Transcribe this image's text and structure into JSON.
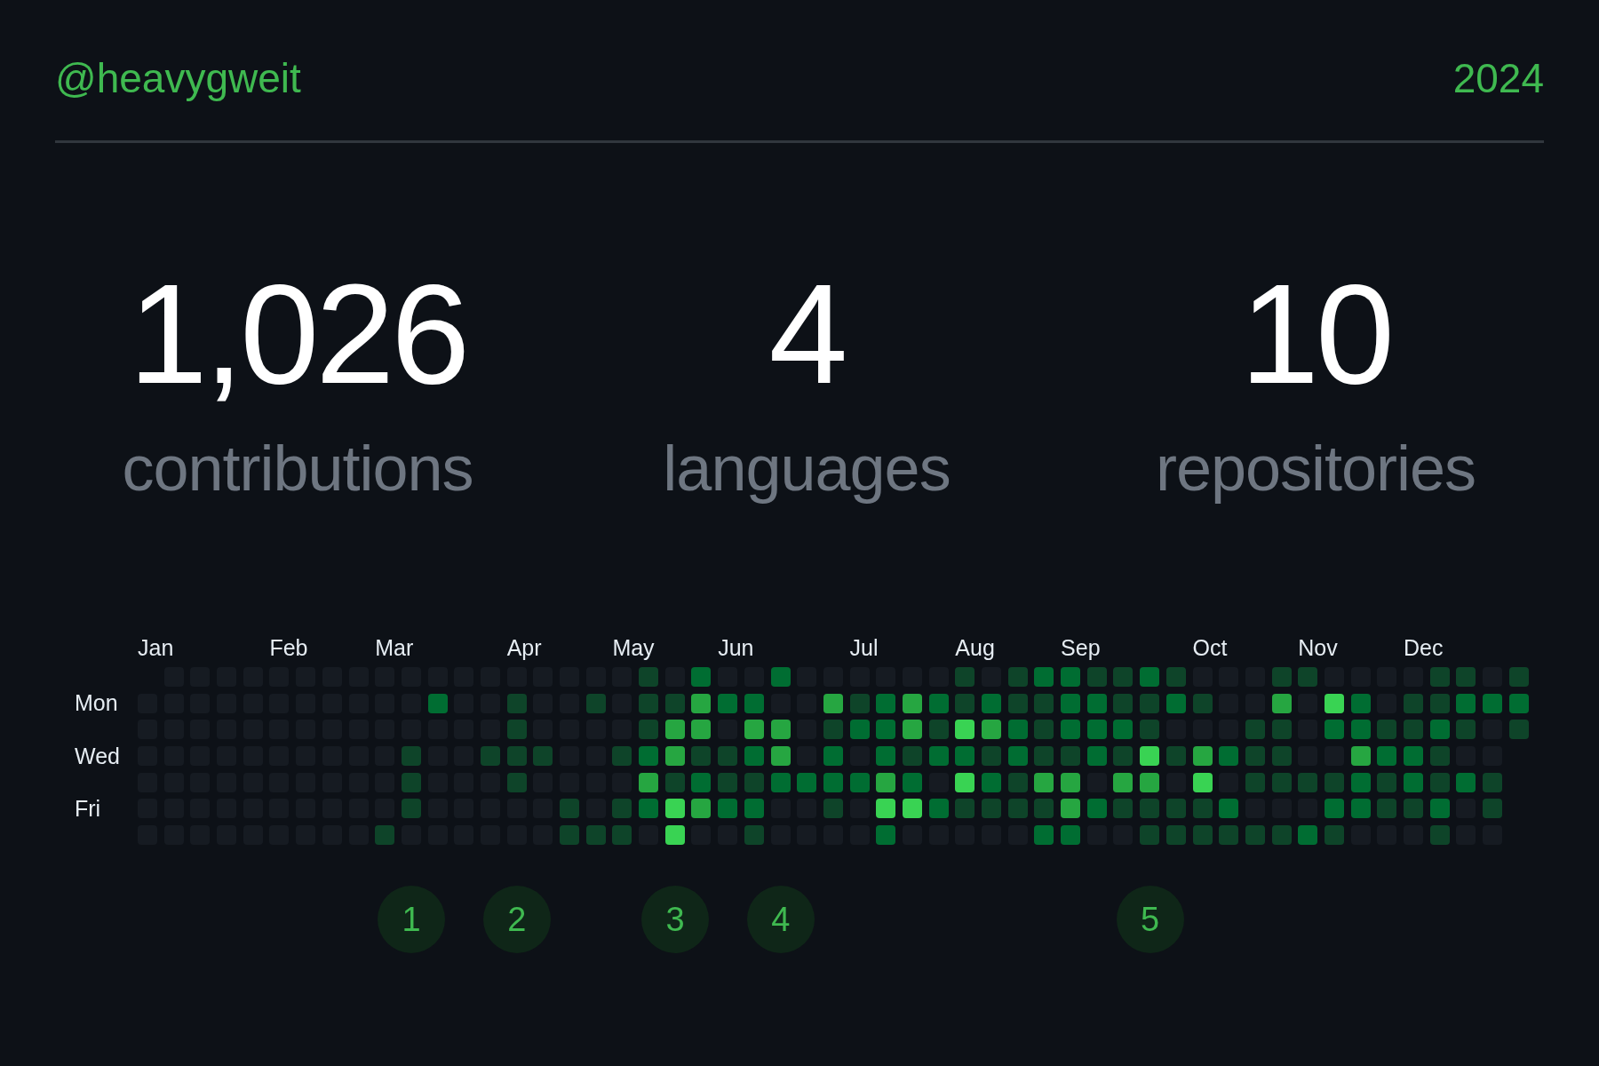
{
  "header": {
    "username": "@heavygweit",
    "year": "2024"
  },
  "stats": [
    {
      "value": "1,026",
      "label": "contributions"
    },
    {
      "value": "4",
      "label": "languages"
    },
    {
      "value": "10",
      "label": "repositories"
    }
  ],
  "calendar": {
    "day_labels": [
      {
        "row": "Mon"
      },
      {
        "row": "Wed"
      },
      {
        "row": "Fri"
      }
    ],
    "weeks": [
      {
        "month": "Jan",
        "days": [
          {
            "color": "#161b22"
          },
          {
            "color": "#161b22"
          },
          {
            "color": "#161b22"
          },
          {
            "color": "#161b22"
          },
          {
            "color": "#161b22"
          },
          {
            "color": "#161b22"
          }
        ]
      },
      {
        "days": [
          {
            "color": "#161b22"
          },
          {
            "color": "#161b22"
          },
          {
            "color": "#161b22"
          },
          {
            "color": "#161b22"
          },
          {
            "color": "#161b22"
          },
          {
            "color": "#161b22"
          },
          {
            "color": "#161b22"
          }
        ]
      },
      {
        "days": [
          {
            "color": "#161b22"
          },
          {
            "color": "#161b22"
          },
          {
            "color": "#161b22"
          },
          {
            "color": "#161b22"
          },
          {
            "color": "#161b22"
          },
          {
            "color": "#161b22"
          },
          {
            "color": "#161b22"
          }
        ]
      },
      {
        "days": [
          {
            "color": "#161b22"
          },
          {
            "color": "#161b22"
          },
          {
            "color": "#161b22"
          },
          {
            "color": "#161b22"
          },
          {
            "color": "#161b22"
          },
          {
            "color": "#161b22"
          },
          {
            "color": "#161b22"
          }
        ]
      },
      {
        "days": [
          {
            "color": "#161b22"
          },
          {
            "color": "#161b22"
          },
          {
            "color": "#161b22"
          },
          {
            "color": "#161b22"
          },
          {
            "color": "#161b22"
          },
          {
            "color": "#161b22"
          },
          {
            "color": "#161b22"
          }
        ]
      },
      {
        "month": "Feb",
        "days": [
          {
            "color": "#161b22"
          },
          {
            "color": "#161b22"
          },
          {
            "color": "#161b22"
          },
          {
            "color": "#161b22"
          },
          {
            "color": "#161b22"
          },
          {
            "color": "#161b22"
          },
          {
            "color": "#161b22"
          }
        ]
      },
      {
        "days": [
          {
            "color": "#161b22"
          },
          {
            "color": "#161b22"
          },
          {
            "color": "#161b22"
          },
          {
            "color": "#161b22"
          },
          {
            "color": "#161b22"
          },
          {
            "color": "#161b22"
          },
          {
            "color": "#161b22"
          }
        ]
      },
      {
        "days": [
          {
            "color": "#161b22"
          },
          {
            "color": "#161b22"
          },
          {
            "color": "#161b22"
          },
          {
            "color": "#161b22"
          },
          {
            "color": "#161b22"
          },
          {
            "color": "#161b22"
          },
          {
            "color": "#161b22"
          }
        ]
      },
      {
        "days": [
          {
            "color": "#161b22"
          },
          {
            "color": "#161b22"
          },
          {
            "color": "#161b22"
          },
          {
            "color": "#161b22"
          },
          {
            "color": "#161b22"
          },
          {
            "color": "#161b22"
          },
          {
            "color": "#161b22"
          }
        ]
      },
      {
        "month": "Mar",
        "days": [
          {
            "color": "#161b22"
          },
          {
            "color": "#161b22"
          },
          {
            "color": "#161b22"
          },
          {
            "color": "#161b22"
          },
          {
            "color": "#161b22"
          },
          {
            "color": "#161b22"
          },
          {
            "color": "#0e4429"
          }
        ]
      },
      {
        "marker": "1",
        "days": [
          {
            "color": "#161b22"
          },
          {
            "color": "#161b22"
          },
          {
            "color": "#161b22"
          },
          {
            "color": "#0e4429"
          },
          {
            "color": "#0e4429"
          },
          {
            "color": "#0e4429"
          },
          {
            "color": "#161b22"
          }
        ]
      },
      {
        "days": [
          {
            "color": "#161b22"
          },
          {
            "color": "#006d32"
          },
          {
            "color": "#161b22"
          },
          {
            "color": "#161b22"
          },
          {
            "color": "#161b22"
          },
          {
            "color": "#161b22"
          },
          {
            "color": "#161b22"
          }
        ]
      },
      {
        "days": [
          {
            "color": "#161b22"
          },
          {
            "color": "#161b22"
          },
          {
            "color": "#161b22"
          },
          {
            "color": "#161b22"
          },
          {
            "color": "#161b22"
          },
          {
            "color": "#161b22"
          },
          {
            "color": "#161b22"
          }
        ]
      },
      {
        "days": [
          {
            "color": "#161b22"
          },
          {
            "color": "#161b22"
          },
          {
            "color": "#161b22"
          },
          {
            "color": "#0e4429"
          },
          {
            "color": "#161b22"
          },
          {
            "color": "#161b22"
          },
          {
            "color": "#161b22"
          }
        ]
      },
      {
        "month": "Apr",
        "marker": "2",
        "days": [
          {
            "color": "#161b22"
          },
          {
            "color": "#0e4429"
          },
          {
            "color": "#0e4429"
          },
          {
            "color": "#0e4429"
          },
          {
            "color": "#0e4429"
          },
          {
            "color": "#161b22"
          },
          {
            "color": "#161b22"
          }
        ]
      },
      {
        "days": [
          {
            "color": "#161b22"
          },
          {
            "color": "#161b22"
          },
          {
            "color": "#161b22"
          },
          {
            "color": "#0e4429"
          },
          {
            "color": "#161b22"
          },
          {
            "color": "#161b22"
          },
          {
            "color": "#161b22"
          }
        ]
      },
      {
        "days": [
          {
            "color": "#161b22"
          },
          {
            "color": "#161b22"
          },
          {
            "color": "#161b22"
          },
          {
            "color": "#161b22"
          },
          {
            "color": "#161b22"
          },
          {
            "color": "#0e4429"
          },
          {
            "color": "#0e4429"
          }
        ]
      },
      {
        "days": [
          {
            "color": "#161b22"
          },
          {
            "color": "#0e4429"
          },
          {
            "color": "#161b22"
          },
          {
            "color": "#161b22"
          },
          {
            "color": "#161b22"
          },
          {
            "color": "#161b22"
          },
          {
            "color": "#0e4429"
          }
        ]
      },
      {
        "month": "May",
        "days": [
          {
            "color": "#161b22"
          },
          {
            "color": "#161b22"
          },
          {
            "color": "#161b22"
          },
          {
            "color": "#0e4429"
          },
          {
            "color": "#161b22"
          },
          {
            "color": "#0e4429"
          },
          {
            "color": "#0e4429"
          }
        ]
      },
      {
        "days": [
          {
            "color": "#0e4429"
          },
          {
            "color": "#0e4429"
          },
          {
            "color": "#0e4429"
          },
          {
            "color": "#006d32"
          },
          {
            "color": "#26a641"
          },
          {
            "color": "#006d32"
          },
          {
            "color": "#161b22"
          }
        ]
      },
      {
        "marker": "3",
        "days": [
          {
            "color": "#161b22"
          },
          {
            "color": "#0e4429"
          },
          {
            "color": "#26a641"
          },
          {
            "color": "#26a641"
          },
          {
            "color": "#0e4429"
          },
          {
            "color": "#39d353"
          },
          {
            "color": "#39d353"
          }
        ]
      },
      {
        "days": [
          {
            "color": "#006d32"
          },
          {
            "color": "#26a641"
          },
          {
            "color": "#26a641"
          },
          {
            "color": "#0e4429"
          },
          {
            "color": "#006d32"
          },
          {
            "color": "#26a641"
          },
          {
            "color": "#161b22"
          }
        ]
      },
      {
        "month": "Jun",
        "days": [
          {
            "color": "#161b22"
          },
          {
            "color": "#006d32"
          },
          {
            "color": "#161b22"
          },
          {
            "color": "#0e4429"
          },
          {
            "color": "#0e4429"
          },
          {
            "color": "#006d32"
          },
          {
            "color": "#161b22"
          }
        ]
      },
      {
        "days": [
          {
            "color": "#161b22"
          },
          {
            "color": "#006d32"
          },
          {
            "color": "#26a641"
          },
          {
            "color": "#006d32"
          },
          {
            "color": "#0e4429"
          },
          {
            "color": "#006d32"
          },
          {
            "color": "#0e4429"
          }
        ]
      },
      {
        "marker": "4",
        "days": [
          {
            "color": "#006d32"
          },
          {
            "color": "#161b22"
          },
          {
            "color": "#26a641"
          },
          {
            "color": "#26a641"
          },
          {
            "color": "#006d32"
          },
          {
            "color": "#161b22"
          },
          {
            "color": "#161b22"
          }
        ]
      },
      {
        "days": [
          {
            "color": "#161b22"
          },
          {
            "color": "#161b22"
          },
          {
            "color": "#161b22"
          },
          {
            "color": "#161b22"
          },
          {
            "color": "#006d32"
          },
          {
            "color": "#161b22"
          },
          {
            "color": "#161b22"
          }
        ]
      },
      {
        "days": [
          {
            "color": "#161b22"
          },
          {
            "color": "#26a641"
          },
          {
            "color": "#0e4429"
          },
          {
            "color": "#006d32"
          },
          {
            "color": "#006d32"
          },
          {
            "color": "#0e4429"
          },
          {
            "color": "#161b22"
          }
        ]
      },
      {
        "month": "Jul",
        "days": [
          {
            "color": "#161b22"
          },
          {
            "color": "#0e4429"
          },
          {
            "color": "#006d32"
          },
          {
            "color": "#161b22"
          },
          {
            "color": "#006d32"
          },
          {
            "color": "#161b22"
          },
          {
            "color": "#161b22"
          }
        ]
      },
      {
        "days": [
          {
            "color": "#161b22"
          },
          {
            "color": "#006d32"
          },
          {
            "color": "#006d32"
          },
          {
            "color": "#006d32"
          },
          {
            "color": "#26a641"
          },
          {
            "color": "#39d353"
          },
          {
            "color": "#006d32"
          }
        ]
      },
      {
        "days": [
          {
            "color": "#161b22"
          },
          {
            "color": "#26a641"
          },
          {
            "color": "#26a641"
          },
          {
            "color": "#0e4429"
          },
          {
            "color": "#006d32"
          },
          {
            "color": "#39d353"
          },
          {
            "color": "#161b22"
          }
        ]
      },
      {
        "days": [
          {
            "color": "#161b22"
          },
          {
            "color": "#006d32"
          },
          {
            "color": "#0e4429"
          },
          {
            "color": "#006d32"
          },
          {
            "color": "#161b22"
          },
          {
            "color": "#006d32"
          },
          {
            "color": "#161b22"
          }
        ]
      },
      {
        "month": "Aug",
        "days": [
          {
            "color": "#0e4429"
          },
          {
            "color": "#0e4429"
          },
          {
            "color": "#39d353"
          },
          {
            "color": "#006d32"
          },
          {
            "color": "#39d353"
          },
          {
            "color": "#0e4429"
          },
          {
            "color": "#161b22"
          }
        ]
      },
      {
        "days": [
          {
            "color": "#161b22"
          },
          {
            "color": "#006d32"
          },
          {
            "color": "#26a641"
          },
          {
            "color": "#0e4429"
          },
          {
            "color": "#006d32"
          },
          {
            "color": "#0e4429"
          },
          {
            "color": "#161b22"
          }
        ]
      },
      {
        "days": [
          {
            "color": "#0e4429"
          },
          {
            "color": "#0e4429"
          },
          {
            "color": "#006d32"
          },
          {
            "color": "#006d32"
          },
          {
            "color": "#0e4429"
          },
          {
            "color": "#0e4429"
          },
          {
            "color": "#161b22"
          }
        ]
      },
      {
        "days": [
          {
            "color": "#006d32"
          },
          {
            "color": "#0e4429"
          },
          {
            "color": "#0e4429"
          },
          {
            "color": "#0e4429"
          },
          {
            "color": "#26a641"
          },
          {
            "color": "#0e4429"
          },
          {
            "color": "#006d32"
          }
        ]
      },
      {
        "month": "Sep",
        "days": [
          {
            "color": "#006d32"
          },
          {
            "color": "#006d32"
          },
          {
            "color": "#006d32"
          },
          {
            "color": "#0e4429"
          },
          {
            "color": "#26a641"
          },
          {
            "color": "#26a641"
          },
          {
            "color": "#006d32"
          }
        ]
      },
      {
        "days": [
          {
            "color": "#0e4429"
          },
          {
            "color": "#006d32"
          },
          {
            "color": "#006d32"
          },
          {
            "color": "#006d32"
          },
          {
            "color": "#161b22"
          },
          {
            "color": "#006d32"
          },
          {
            "color": "#161b22"
          }
        ]
      },
      {
        "days": [
          {
            "color": "#0e4429"
          },
          {
            "color": "#0e4429"
          },
          {
            "color": "#006d32"
          },
          {
            "color": "#0e4429"
          },
          {
            "color": "#26a641"
          },
          {
            "color": "#0e4429"
          },
          {
            "color": "#161b22"
          }
        ]
      },
      {
        "marker": "5",
        "days": [
          {
            "color": "#006d32"
          },
          {
            "color": "#0e4429"
          },
          {
            "color": "#0e4429"
          },
          {
            "color": "#39d353"
          },
          {
            "color": "#26a641"
          },
          {
            "color": "#0e4429"
          },
          {
            "color": "#0e4429"
          }
        ]
      },
      {
        "days": [
          {
            "color": "#0e4429"
          },
          {
            "color": "#006d32"
          },
          {
            "color": "#161b22"
          },
          {
            "color": "#0e4429"
          },
          {
            "color": "#161b22"
          },
          {
            "color": "#0e4429"
          },
          {
            "color": "#0e4429"
          }
        ]
      },
      {
        "month": "Oct",
        "days": [
          {
            "color": "#161b22"
          },
          {
            "color": "#0e4429"
          },
          {
            "color": "#161b22"
          },
          {
            "color": "#26a641"
          },
          {
            "color": "#39d353"
          },
          {
            "color": "#0e4429"
          },
          {
            "color": "#0e4429"
          }
        ]
      },
      {
        "days": [
          {
            "color": "#161b22"
          },
          {
            "color": "#161b22"
          },
          {
            "color": "#161b22"
          },
          {
            "color": "#006d32"
          },
          {
            "color": "#161b22"
          },
          {
            "color": "#006d32"
          },
          {
            "color": "#0e4429"
          }
        ]
      },
      {
        "days": [
          {
            "color": "#161b22"
          },
          {
            "color": "#161b22"
          },
          {
            "color": "#0e4429"
          },
          {
            "color": "#0e4429"
          },
          {
            "color": "#0e4429"
          },
          {
            "color": "#161b22"
          },
          {
            "color": "#0e4429"
          }
        ]
      },
      {
        "days": [
          {
            "color": "#0e4429"
          },
          {
            "color": "#26a641"
          },
          {
            "color": "#0e4429"
          },
          {
            "color": "#0e4429"
          },
          {
            "color": "#0e4429"
          },
          {
            "color": "#161b22"
          },
          {
            "color": "#0e4429"
          }
        ]
      },
      {
        "month": "Nov",
        "days": [
          {
            "color": "#0e4429"
          },
          {
            "color": "#161b22"
          },
          {
            "color": "#161b22"
          },
          {
            "color": "#161b22"
          },
          {
            "color": "#0e4429"
          },
          {
            "color": "#161b22"
          },
          {
            "color": "#006d32"
          }
        ]
      },
      {
        "days": [
          {
            "color": "#161b22"
          },
          {
            "color": "#39d353"
          },
          {
            "color": "#006d32"
          },
          {
            "color": "#161b22"
          },
          {
            "color": "#0e4429"
          },
          {
            "color": "#006d32"
          },
          {
            "color": "#0e4429"
          }
        ]
      },
      {
        "days": [
          {
            "color": "#161b22"
          },
          {
            "color": "#006d32"
          },
          {
            "color": "#006d32"
          },
          {
            "color": "#26a641"
          },
          {
            "color": "#006d32"
          },
          {
            "color": "#006d32"
          },
          {
            "color": "#161b22"
          }
        ]
      },
      {
        "days": [
          {
            "color": "#161b22"
          },
          {
            "color": "#161b22"
          },
          {
            "color": "#0e4429"
          },
          {
            "color": "#006d32"
          },
          {
            "color": "#0e4429"
          },
          {
            "color": "#0e4429"
          },
          {
            "color": "#161b22"
          }
        ]
      },
      {
        "month": "Dec",
        "days": [
          {
            "color": "#161b22"
          },
          {
            "color": "#0e4429"
          },
          {
            "color": "#0e4429"
          },
          {
            "color": "#006d32"
          },
          {
            "color": "#006d32"
          },
          {
            "color": "#0e4429"
          },
          {
            "color": "#161b22"
          }
        ]
      },
      {
        "days": [
          {
            "color": "#0e4429"
          },
          {
            "color": "#0e4429"
          },
          {
            "color": "#006d32"
          },
          {
            "color": "#0e4429"
          },
          {
            "color": "#0e4429"
          },
          {
            "color": "#006d32"
          },
          {
            "color": "#0e4429"
          }
        ]
      },
      {
        "days": [
          {
            "color": "#0e4429"
          },
          {
            "color": "#006d32"
          },
          {
            "color": "#0e4429"
          },
          {
            "color": "#161b22"
          },
          {
            "color": "#006d32"
          },
          {
            "color": "#161b22"
          },
          {
            "color": "#161b22"
          }
        ]
      },
      {
        "days": [
          {
            "color": "#161b22"
          },
          {
            "color": "#006d32"
          },
          {
            "color": "#161b22"
          },
          {
            "color": "#161b22"
          },
          {
            "color": "#0e4429"
          },
          {
            "color": "#0e4429"
          },
          {
            "color": "#161b22"
          }
        ]
      },
      {
        "days": [
          {
            "color": "#0e4429"
          },
          {
            "color": "#006d32"
          },
          {
            "color": "#0e4429"
          }
        ]
      }
    ]
  }
}
